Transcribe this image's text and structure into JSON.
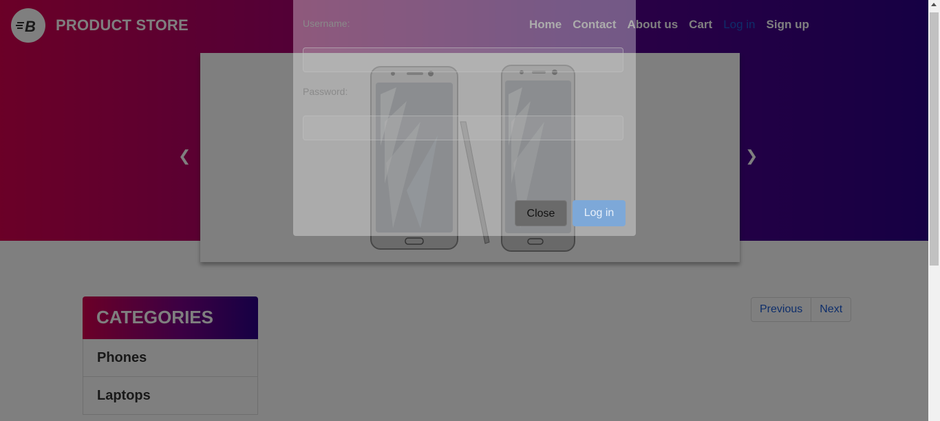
{
  "brand": {
    "title": "PRODUCT STORE",
    "logo_icon": "store-logo-icon",
    "logo_letter": "B"
  },
  "nav": {
    "items": [
      {
        "label": "Home"
      },
      {
        "label": "Contact"
      },
      {
        "label": "About us"
      },
      {
        "label": "Cart"
      },
      {
        "label": "Log in",
        "active": true
      },
      {
        "label": "Sign up"
      }
    ]
  },
  "carousel": {
    "prev_icon": "chevron-left-icon",
    "next_icon": "chevron-right-icon",
    "image": "samsung-phones-image"
  },
  "categories": {
    "title": "CATEGORIES",
    "items": [
      {
        "label": "Phones"
      },
      {
        "label": "Laptops"
      }
    ]
  },
  "pagination": {
    "previous": "Previous",
    "next": "Next"
  },
  "login_modal": {
    "username_label": "Username:",
    "username_value": "",
    "password_label": "Password:",
    "password_value": "",
    "close_label": "Close",
    "login_label": "Log in"
  },
  "colors": {
    "brand_start": "#d6004f",
    "brand_end": "#2c0088",
    "link_blue": "#1c5dd6"
  }
}
